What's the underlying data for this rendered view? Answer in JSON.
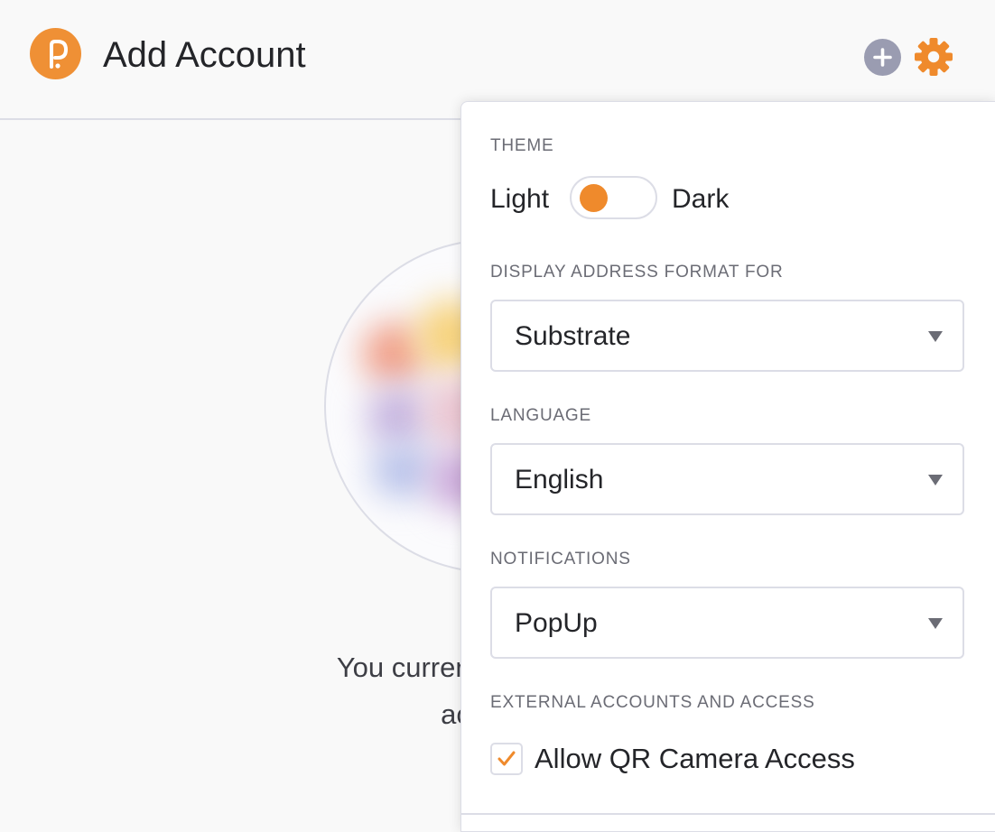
{
  "header": {
    "title": "Add Account",
    "logo_icon": "polkadot-logo-icon",
    "add_icon": "plus-circle-icon",
    "settings_icon": "gear-icon",
    "accent_color": "#ef9035"
  },
  "empty_state": {
    "line1": "You currently don't have a",
    "line2": "account t"
  },
  "settings_menu": {
    "theme": {
      "label": "THEME",
      "light_label": "Light",
      "dark_label": "Dark",
      "selected": "Light"
    },
    "address_format": {
      "label": "DISPLAY ADDRESS FORMAT FOR",
      "value": "Substrate"
    },
    "language": {
      "label": "LANGUAGE",
      "value": "English"
    },
    "notifications": {
      "label": "NOTIFICATIONS",
      "value": "PopUp"
    },
    "external": {
      "label": "EXTERNAL ACCOUNTS AND ACCESS",
      "camera_label": "Allow QR Camera Access",
      "camera_checked": true
    }
  }
}
